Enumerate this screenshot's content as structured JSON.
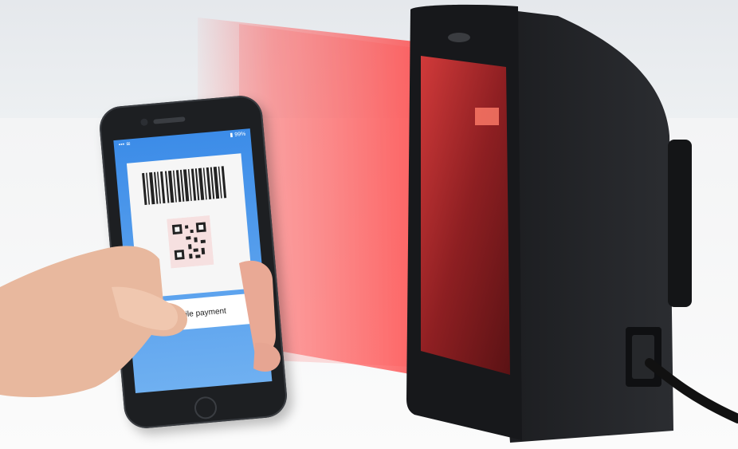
{
  "scene": {
    "description_free": true,
    "colors": {
      "beam": "#ff5a5a",
      "scanner": "#1b1c1f",
      "phone_screen": "#3c8ce8"
    }
  },
  "phone": {
    "status_left": "••• ≋",
    "status_right": "▮ 99%",
    "payment_label": "Mobile payment"
  }
}
